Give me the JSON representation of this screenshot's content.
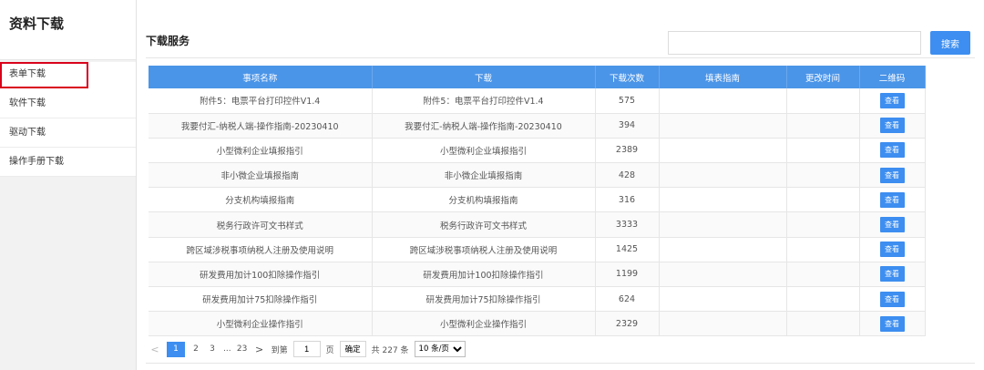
{
  "sidebar": {
    "title": "资料下载",
    "items": [
      {
        "label": "表单下载"
      },
      {
        "label": "软件下载"
      },
      {
        "label": "驱动下载"
      },
      {
        "label": "操作手册下载"
      }
    ]
  },
  "main": {
    "title": "下载服务",
    "search": {
      "value": "",
      "placeholder": "",
      "button_label": "搜索"
    }
  },
  "table": {
    "headers": [
      "事项名称",
      "下载",
      "下载次数",
      "填表指南",
      "更改时间",
      "二维码"
    ],
    "view_label": "查看",
    "rows": [
      {
        "name": "附件5：电票平台打印控件V1.4",
        "download": "附件5：电票平台打印控件V1.4",
        "count": "575"
      },
      {
        "name": "我要付汇-纳税人端-操作指南-20230410",
        "download": "我要付汇-纳税人端-操作指南-20230410",
        "count": "394"
      },
      {
        "name": "小型微利企业填报指引",
        "download": "小型微利企业填报指引",
        "count": "2389"
      },
      {
        "name": "非小微企业填报指南",
        "download": "非小微企业填报指南",
        "count": "428"
      },
      {
        "name": "分支机构填报指南",
        "download": "分支机构填报指南",
        "count": "316"
      },
      {
        "name": "税务行政许可文书样式",
        "download": "税务行政许可文书样式",
        "count": "3333"
      },
      {
        "name": "跨区域涉税事项纳税人注册及使用说明",
        "download": "跨区域涉税事项纳税人注册及使用说明",
        "count": "1425"
      },
      {
        "name": "研发费用加计100扣除操作指引",
        "download": "研发费用加计100扣除操作指引",
        "count": "1199"
      },
      {
        "name": "研发费用加计75扣除操作指引",
        "download": "研发费用加计75扣除操作指引",
        "count": "624"
      },
      {
        "name": "小型微利企业操作指引",
        "download": "小型微利企业操作指引",
        "count": "2329"
      }
    ]
  },
  "pagination": {
    "prev": "<",
    "pages": [
      "1",
      "2",
      "3"
    ],
    "ellipsis": "...",
    "last_page": "23",
    "next": ">",
    "goto_label": "到第",
    "goto_value": "1",
    "page_unit": "页",
    "confirm_label": "确定",
    "total": "共 227 条",
    "page_size": "10 条/页"
  }
}
